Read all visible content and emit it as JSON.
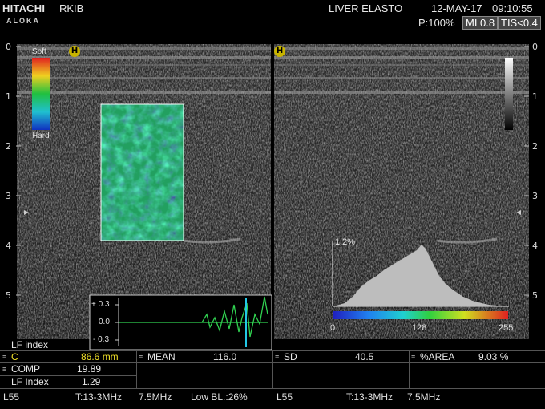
{
  "header": {
    "brand": "HITACHI",
    "brand_sub": "ALOKA",
    "operator": "RKIB",
    "exam": "LIVER ELASTO",
    "date": "12-MAY-17",
    "time": "09:10:55",
    "power": "P:100%",
    "mi": "MI 0.8",
    "tis": "TIS<0.4"
  },
  "depth_scale": [
    "0",
    "1",
    "2",
    "3",
    "4",
    "5"
  ],
  "elasto_bar": {
    "soft_label": "Soft",
    "hard_label": "Hard"
  },
  "orientation_marker": "H",
  "strain_graph": {
    "ticks": [
      "+ 0.3",
      "0.0",
      "- 0.3"
    ]
  },
  "histogram": {
    "peak_label": "1.2%",
    "axis_ticks": [
      "0",
      "128",
      "255"
    ]
  },
  "table": {
    "title": "LF index",
    "c_label": "C",
    "c_value": "86.6 mm",
    "mean_label": "MEAN",
    "mean_value": "116.0",
    "sd_label": "SD",
    "sd_value": "40.5",
    "area_label": "%AREA",
    "area_value": "9.03 %",
    "comp_label": "COMP",
    "comp_value": "19.89",
    "lfi_label": "LF Index",
    "lfi_value": "1.29"
  },
  "footer": {
    "probe_left": "L55",
    "freq_left": "T:13-3MHz",
    "mhz_left": "7.5MHz",
    "baseline": "Low BL.:26%",
    "probe_right": "L55",
    "freq_right": "T:13-3MHz",
    "mhz_right": "7.5MHz"
  },
  "colors": {
    "yellow": "#f0e028",
    "cursor_cyan": "#23c8e6",
    "strain_green": "#30d050"
  }
}
